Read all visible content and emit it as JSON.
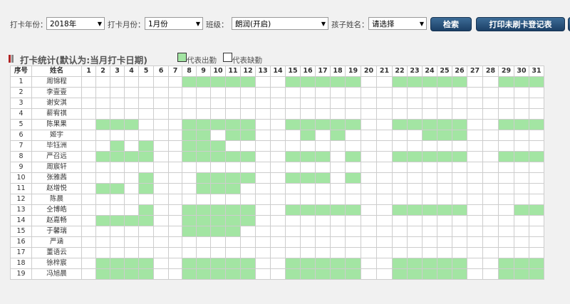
{
  "filters": {
    "year_label": "打卡年份：",
    "year_value": "2018年",
    "month_label": "打卡月份：",
    "month_value": "1月份",
    "class_label": "班级：",
    "class_value": "朗润(开启)",
    "child_label": "孩子姓名：",
    "child_value": "请选择",
    "search_button": "检索",
    "print_button": "打印未刷卡登记表"
  },
  "section": {
    "title": "打卡统计(默认为:当月打卡日期)",
    "legend_present": "代表出勤",
    "legend_absent": "代表缺勤"
  },
  "colors": {
    "present": "#a3e5a3",
    "absent": "#ffffff",
    "marker_red": "#b22222",
    "marker_gray": "#888888",
    "button": "#1f4a75"
  },
  "table": {
    "headers": {
      "index": "序号",
      "name": "姓名"
    },
    "days": [
      "1",
      "2",
      "3",
      "4",
      "5",
      "6",
      "7",
      "8",
      "9",
      "10",
      "11",
      "12",
      "13",
      "14",
      "15",
      "16",
      "17",
      "18",
      "19",
      "20",
      "21",
      "22",
      "23",
      "24",
      "25",
      "26",
      "27",
      "28",
      "29",
      "30",
      "31"
    ],
    "rows": [
      {
        "index": "1",
        "name": "周锦程",
        "present": [
          8,
          9,
          10,
          11,
          12,
          15,
          16,
          17,
          18,
          19,
          22,
          23,
          24,
          25,
          26,
          29,
          30,
          31
        ]
      },
      {
        "index": "2",
        "name": "李壹壹",
        "present": []
      },
      {
        "index": "3",
        "name": "谢安淇",
        "present": []
      },
      {
        "index": "4",
        "name": "薪宥祺",
        "present": []
      },
      {
        "index": "5",
        "name": "陈果果",
        "present": [
          2,
          3,
          4,
          8,
          9,
          10,
          11,
          12,
          15,
          16,
          17,
          18,
          19,
          22,
          23,
          24,
          25,
          26,
          29,
          30,
          31
        ]
      },
      {
        "index": "6",
        "name": "姬宇",
        "present": [
          8,
          9,
          11,
          12,
          16,
          18,
          24,
          25,
          26
        ]
      },
      {
        "index": "7",
        "name": "毕钰洲",
        "present": [
          3,
          5,
          8,
          9,
          10
        ]
      },
      {
        "index": "8",
        "name": "严召远",
        "present": [
          2,
          3,
          4,
          5,
          8,
          9,
          10,
          11,
          12,
          15,
          16,
          17,
          19,
          22,
          23,
          24,
          25,
          26,
          29,
          30,
          31
        ]
      },
      {
        "index": "9",
        "name": "周宸轩",
        "present": []
      },
      {
        "index": "10",
        "name": "张雅茜",
        "present": [
          5,
          9,
          10,
          11,
          12,
          15,
          16,
          17,
          19
        ]
      },
      {
        "index": "11",
        "name": "赵增悦",
        "present": [
          2,
          3,
          5,
          9,
          10,
          11
        ]
      },
      {
        "index": "12",
        "name": "陈晨",
        "present": []
      },
      {
        "index": "13",
        "name": "仝博皓",
        "present": [
          5,
          8,
          9,
          10,
          11,
          12,
          15,
          16,
          17,
          18,
          19,
          22,
          23,
          24,
          25,
          26,
          30,
          31
        ]
      },
      {
        "index": "14",
        "name": "赵嘉畅",
        "present": [
          2,
          3,
          4,
          5,
          8,
          9,
          10,
          11,
          12
        ]
      },
      {
        "index": "15",
        "name": "于馨瑞",
        "present": [
          8,
          9,
          10,
          11
        ]
      },
      {
        "index": "16",
        "name": "严涵",
        "present": []
      },
      {
        "index": "17",
        "name": "董语云",
        "present": []
      },
      {
        "index": "18",
        "name": "徐梓宸",
        "present": [
          2,
          3,
          4,
          5,
          8,
          9,
          10,
          11,
          12,
          15,
          16,
          17,
          18,
          19,
          22,
          23,
          24,
          25,
          26,
          29,
          30,
          31
        ]
      },
      {
        "index": "19",
        "name": "冯旭晨",
        "present": [
          2,
          3,
          4,
          5,
          8,
          9,
          10,
          11,
          12,
          15,
          16,
          17,
          18,
          19,
          22,
          23,
          24,
          25,
          26,
          29,
          30,
          31
        ]
      }
    ]
  }
}
